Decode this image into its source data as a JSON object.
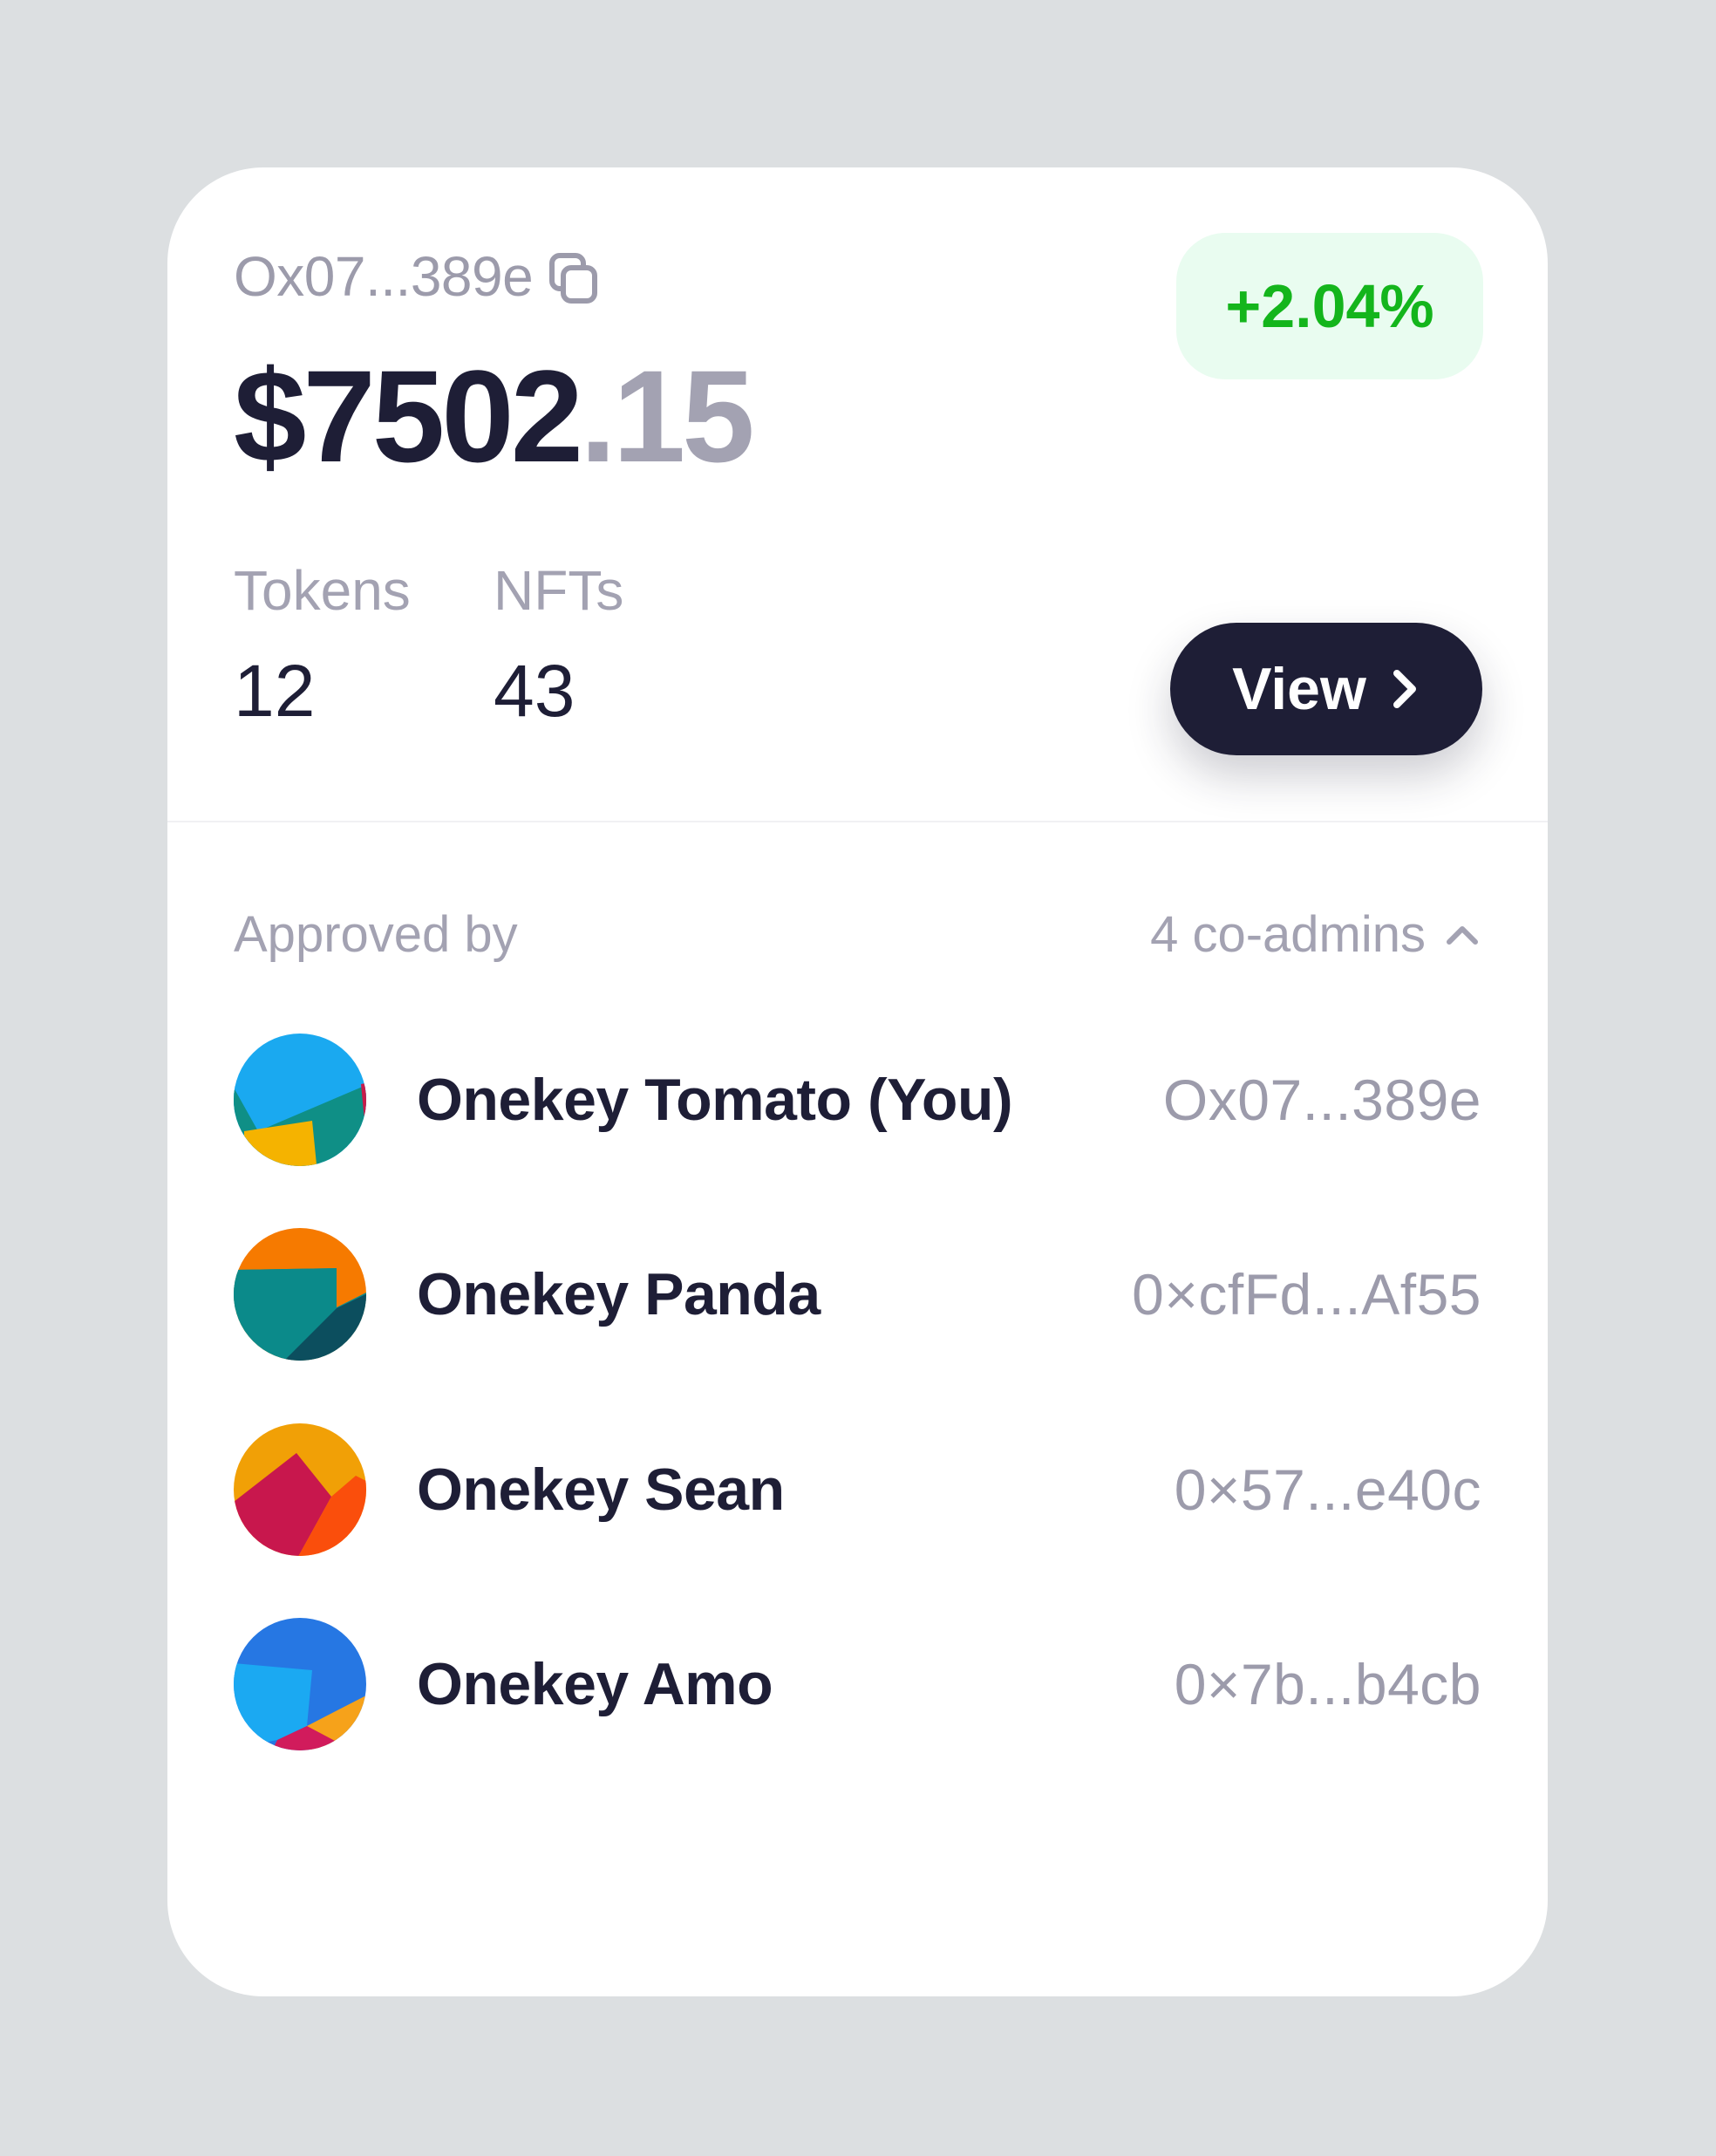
{
  "wallet": {
    "address": "Ox07...389e",
    "balance_whole": "$7502",
    "balance_cents": ".15",
    "change": "+2.04%",
    "copy_icon": "copy-icon",
    "colors": {
      "positive": "#14b51c",
      "positive_bg": "#e9fcf0",
      "primary": "#1e1e36"
    }
  },
  "stats": {
    "tokens_label": "Tokens",
    "tokens_value": "12",
    "nfts_label": "NFTs",
    "nfts_value": "43"
  },
  "actions": {
    "view_label": "View",
    "view_icon": "chevron-right-icon"
  },
  "approvals": {
    "label": "Approved by",
    "count_label": "4 co-admins",
    "toggle_icon": "chevron-up-icon",
    "admins": [
      {
        "name": "Onekey Tomato (You)",
        "address": "Ox07...389e",
        "avatar": "avatar-tomato"
      },
      {
        "name": "Onekey Panda",
        "address": "0×cfFd...Af55",
        "avatar": "avatar-panda"
      },
      {
        "name": "Onekey Sean",
        "address": "0×57...e40c",
        "avatar": "avatar-sean"
      },
      {
        "name": "Onekey Amo",
        "address": "0×7b...b4cb",
        "avatar": "avatar-amo"
      }
    ]
  }
}
